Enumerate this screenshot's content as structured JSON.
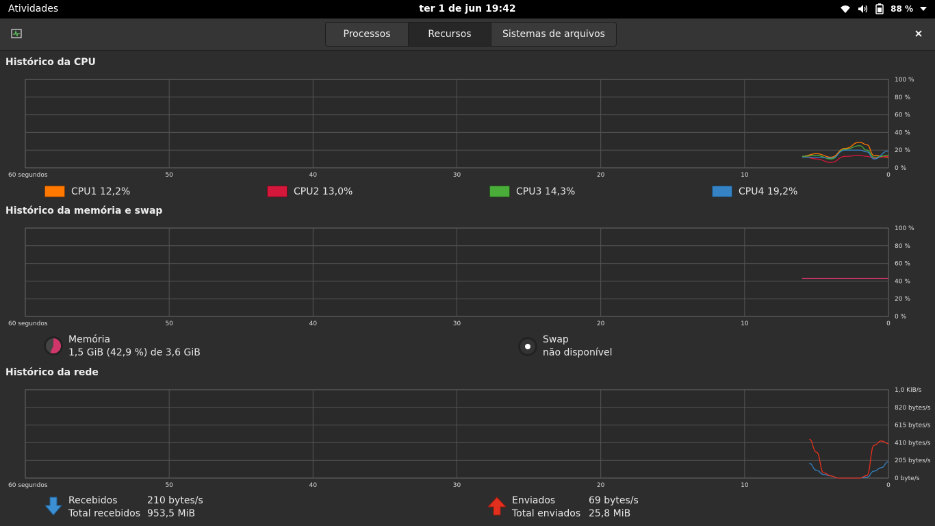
{
  "topbar": {
    "activities": "Atividades",
    "clock": "ter 1 de jun  19:42",
    "battery": "88 %",
    "icons": [
      "wifi-icon",
      "volume-icon",
      "battery-icon",
      "dropdown-arrow-icon"
    ]
  },
  "header": {
    "tabs": [
      "Processos",
      "Recursos",
      "Sistemas de arquivos"
    ],
    "active_tab": "Recursos"
  },
  "cpu": {
    "title": "Histórico da CPU",
    "y_ticks": [
      "100 %",
      "80 %",
      "60 %",
      "40 %",
      "20 %",
      "0 %"
    ],
    "x_ticks": [
      "60 segundos",
      "50",
      "40",
      "30",
      "20",
      "10",
      "0"
    ],
    "legend": [
      {
        "name": "CPU1",
        "value": "12,2%",
        "color": "#ff7800"
      },
      {
        "name": "CPU2",
        "value": "13,0%",
        "color": "#d4183b"
      },
      {
        "name": "CPU3",
        "value": "14,3%",
        "color": "#4aad3a"
      },
      {
        "name": "CPU4",
        "value": "19,2%",
        "color": "#3583c4"
      }
    ]
  },
  "memory": {
    "title": "Histórico da memória e swap",
    "y_ticks": [
      "100 %",
      "80 %",
      "60 %",
      "40 %",
      "20 %",
      "0 %"
    ],
    "x_ticks": [
      "60 segundos",
      "50",
      "40",
      "30",
      "20",
      "10",
      "0"
    ],
    "mem_label": "Memória",
    "mem_value": "1,5 GiB (42,9 %) de 3,6 GiB",
    "mem_color": "#d1366a",
    "swap_label": "Swap",
    "swap_value": "não disponível"
  },
  "network": {
    "title": "Histórico da rede",
    "y_ticks": [
      "1,0 KiB/s",
      "820 bytes/s",
      "615 bytes/s",
      "410 bytes/s",
      "205 bytes/s",
      "0 byte/s"
    ],
    "x_ticks": [
      "60 segundos",
      "50",
      "40",
      "30",
      "20",
      "10",
      "0"
    ],
    "received_label": "Recebidos",
    "received_value": "210 bytes/s",
    "total_received_label": "Total recebidos",
    "total_received_value": "953,5 MiB",
    "sent_label": "Enviados",
    "sent_value": "69 bytes/s",
    "total_sent_label": "Total enviados",
    "total_sent_value": "25,8 MiB",
    "received_color": "#3583c4",
    "sent_color": "#e3301e"
  },
  "chart_data": [
    {
      "type": "line",
      "x": [
        6,
        5,
        4,
        3,
        2,
        1.5,
        1,
        0
      ],
      "series": [
        {
          "name": "CPU1",
          "values": [
            13,
            16,
            12,
            22,
            29,
            26,
            14,
            12
          ]
        },
        {
          "name": "CPU2",
          "values": [
            13,
            10,
            6,
            13,
            14,
            13,
            11,
            13
          ]
        },
        {
          "name": "CPU3",
          "values": [
            13,
            14,
            10,
            21,
            25,
            20,
            12,
            14
          ]
        },
        {
          "name": "CPU4",
          "values": [
            12,
            12,
            11,
            20,
            20,
            18,
            10,
            19
          ]
        }
      ],
      "xlim": [
        60,
        0
      ],
      "ylim": [
        0,
        100
      ]
    },
    {
      "type": "line",
      "x": [
        6,
        0
      ],
      "series": [
        {
          "name": "Memória",
          "values": [
            43,
            43
          ]
        }
      ],
      "xlim": [
        60,
        0
      ],
      "ylim": [
        0,
        100
      ]
    },
    {
      "type": "line",
      "x": [
        5.5,
        5,
        4.5,
        4,
        3.5,
        3,
        2.5,
        2,
        1.5,
        1,
        0.5,
        0
      ],
      "series": [
        {
          "name": "Recebidos",
          "values": [
            170,
            90,
            40,
            25,
            0,
            0,
            0,
            0,
            10,
            80,
            120,
            190
          ]
        },
        {
          "name": "Enviados",
          "values": [
            450,
            300,
            60,
            25,
            0,
            0,
            0,
            0,
            30,
            380,
            430,
            400
          ]
        }
      ],
      "xlim": [
        60,
        0
      ],
      "ylim": [
        0,
        1024
      ]
    }
  ]
}
